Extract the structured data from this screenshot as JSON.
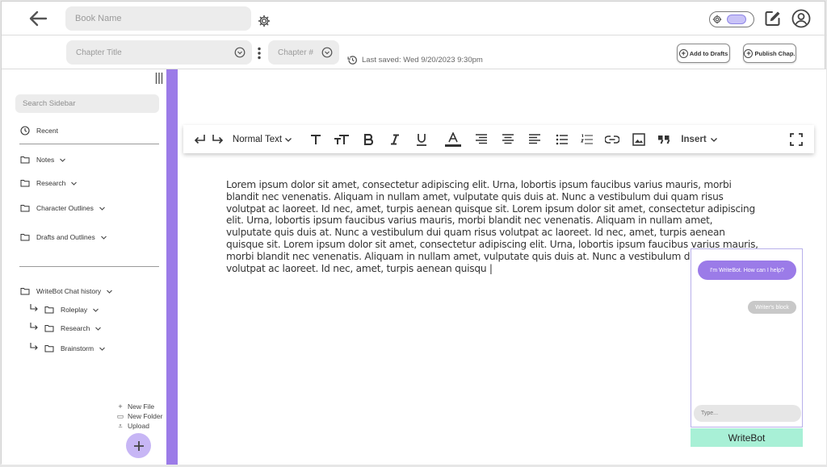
{
  "topbar": {
    "book_name_placeholder": "Book Name"
  },
  "secondbar": {
    "chapter_title_placeholder": "Chapter Title",
    "chapter_number_placeholder": "Chapter #",
    "last_saved": "Last saved: Wed 9/20/2023 9:30pm",
    "add_to_drafts": "Add to Drafts",
    "publish_chapter": "Publish Chap."
  },
  "sidebar": {
    "search_placeholder": "Search Sidebar",
    "recent": "Recent",
    "items": [
      "Notes",
      "Research",
      "Character Outlines",
      "Drafts and Outlines"
    ],
    "chat_history": "WriteBot Chat history",
    "sub_items": [
      "Roleplay",
      "Research",
      "Brainstorm"
    ],
    "file_actions": [
      "New File",
      "New Folder",
      "Upload"
    ]
  },
  "toolbar": {
    "text_style": "Normal Text",
    "insert": "Insert"
  },
  "document": {
    "body": "Lorem ipsum dolor sit amet, consectetur adipiscing elit. Urna, lobortis ipsum faucibus varius mauris,  morbi blandit nec venenatis. Aliquam in nullam amet, vulputate quis duis at. Nunc a vestibulum dui quam  risus volutpat ac laoreet. Id nec, amet, turpis aenean quisque sit. Lorem ipsum dolor sit amet, consectetur adipiscing elit. Urna, lobortis ipsum faucibus varius mauris,  morbi blandit nec venenatis. Aliquam in nullam amet, vulputate quis duis at. Nunc a vestibulum dui quam  risus volutpat ac laoreet. Id nec, amet, turpis aenean quisque sit. Lorem ipsum dolor sit amet, consectetur adipiscing elit. Urna, lobortis ipsum faucibus varius mauris,  morbi blandit nec venenatis. Aliquam in nullam amet, vulputate quis duis at. Nunc a vestibulum dui quam  risus volutpat ac laoreet. Id nec, amet, turpis aenean quisqu |"
  },
  "chat": {
    "bot_message": "I'm WriteBot. How can I help?",
    "user_message": "Writer's block",
    "input_placeholder": "Type...",
    "button_label": "WriteBot"
  },
  "colors": {
    "accent": "#9b7be8",
    "fab": "#c7b6f5",
    "writebot_button": "#a8f0d6",
    "field_bg": "#ececec"
  }
}
